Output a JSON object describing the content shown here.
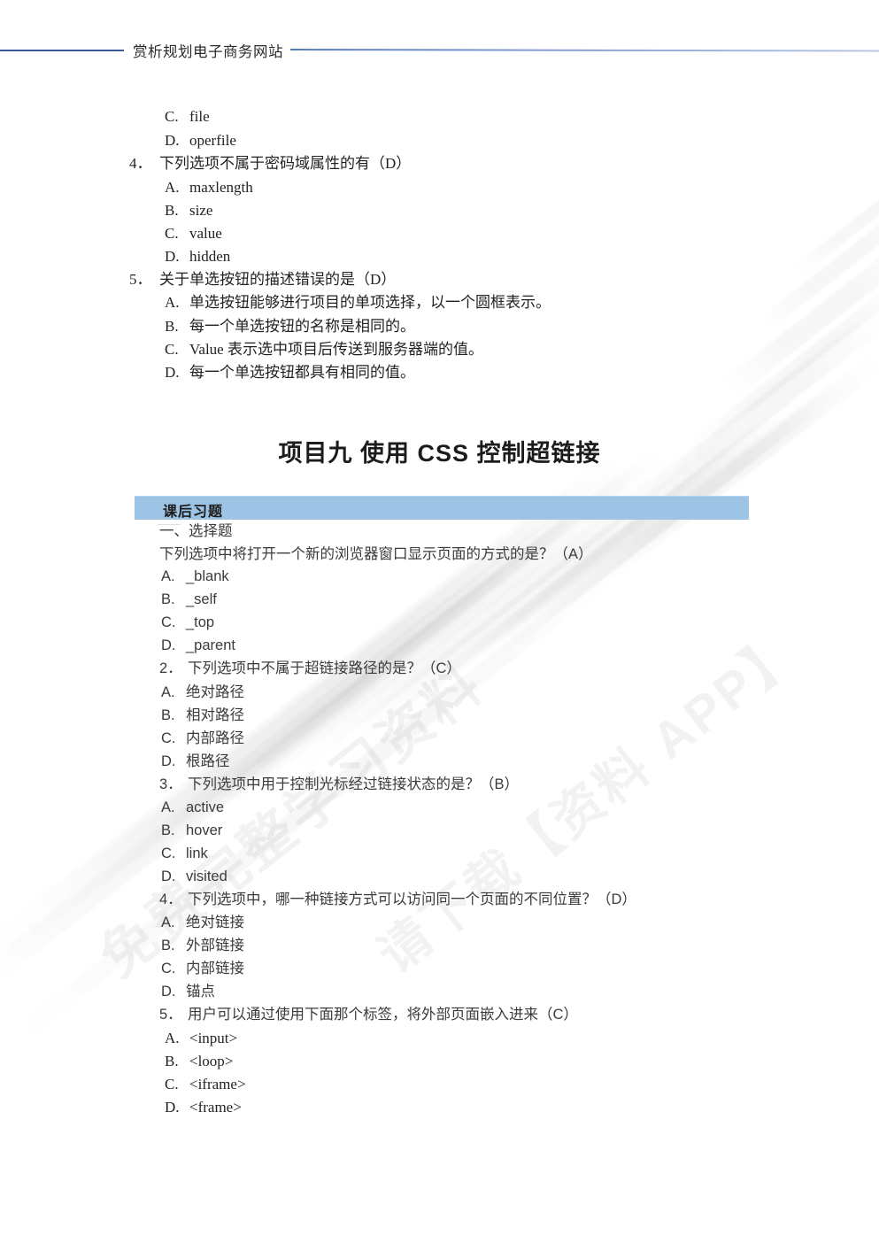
{
  "header": {
    "title": "赏析规划电子商务网站"
  },
  "top_block": {
    "options_continued": [
      {
        "label": "C.",
        "text": "file"
      },
      {
        "label": "D.",
        "text": "operfile"
      }
    ],
    "question4": {
      "number": "4．",
      "text": "下列选项不属于密码域属性的有（D）",
      "options": [
        {
          "label": "A.",
          "text": "maxlength"
        },
        {
          "label": "B.",
          "text": "size"
        },
        {
          "label": "C.",
          "text": "value"
        },
        {
          "label": "D.",
          "text": "hidden"
        }
      ]
    },
    "question5": {
      "number": "5．",
      "text": "关于单选按钮的描述错误的是（D）",
      "options": [
        {
          "label": "A.",
          "text": "单选按钮能够进行项目的单项选择，以一个圆框表示。"
        },
        {
          "label": "B.",
          "text": "每一个单选按钮的名称是相同的。"
        },
        {
          "label": "C.",
          "text": "Value 表示选中项目后传送到服务器端的值。"
        },
        {
          "label": "D.",
          "text": "每一个单选按钮都具有相同的值。"
        }
      ]
    }
  },
  "project": {
    "heading": "项目九  使用 CSS 控制超链接"
  },
  "exercise_section": {
    "bar_label": "课后习题",
    "bar_color": "#9ec4e5",
    "subsection": "一、选择题",
    "question1": {
      "text": "下列选项中将打开一个新的浏览器窗口显示页面的方式的是？（A）",
      "options": [
        {
          "label": "A.",
          "text": "_blank"
        },
        {
          "label": "B.",
          "text": "_self"
        },
        {
          "label": "C.",
          "text": "_top"
        },
        {
          "label": "D.",
          "text": "_parent"
        }
      ]
    },
    "question2": {
      "number": "2．",
      "text": "下列选项中不属于超链接路径的是？（C）",
      "options": [
        {
          "label": "A.",
          "text": "绝对路径"
        },
        {
          "label": "B.",
          "text": "相对路径"
        },
        {
          "label": "C.",
          "text": "内部路径"
        },
        {
          "label": "D.",
          "text": "根路径"
        }
      ]
    },
    "question3": {
      "number": "3．",
      "text": "下列选项中用于控制光标经过链接状态的是？（B）",
      "options": [
        {
          "label": "A.",
          "text": "active"
        },
        {
          "label": "B.",
          "text": "hover"
        },
        {
          "label": "C.",
          "text": "link"
        },
        {
          "label": "D.",
          "text": "visited"
        }
      ]
    },
    "question4": {
      "number": "4．",
      "text": "下列选项中，哪一种链接方式可以访问同一个页面的不同位置？（D）",
      "options": [
        {
          "label": "A.",
          "text": "绝对链接"
        },
        {
          "label": "B.",
          "text": "外部链接"
        },
        {
          "label": "C.",
          "text": "内部链接"
        },
        {
          "label": "D.",
          "text": "锚点"
        }
      ]
    },
    "question5": {
      "number": "5．",
      "text": "用户可以通过使用下面那个标签，将外部页面嵌入进来（C）",
      "options": [
        {
          "label": "A.",
          "text": "<input>"
        },
        {
          "label": "B.",
          "text": "<loop>"
        },
        {
          "label": "C.",
          "text": "<iframe>"
        },
        {
          "label": "D.",
          "text": "<frame>"
        }
      ]
    }
  },
  "watermark": {
    "line1": "免费完整学习资料",
    "line2": "请下载【资料 APP】"
  }
}
